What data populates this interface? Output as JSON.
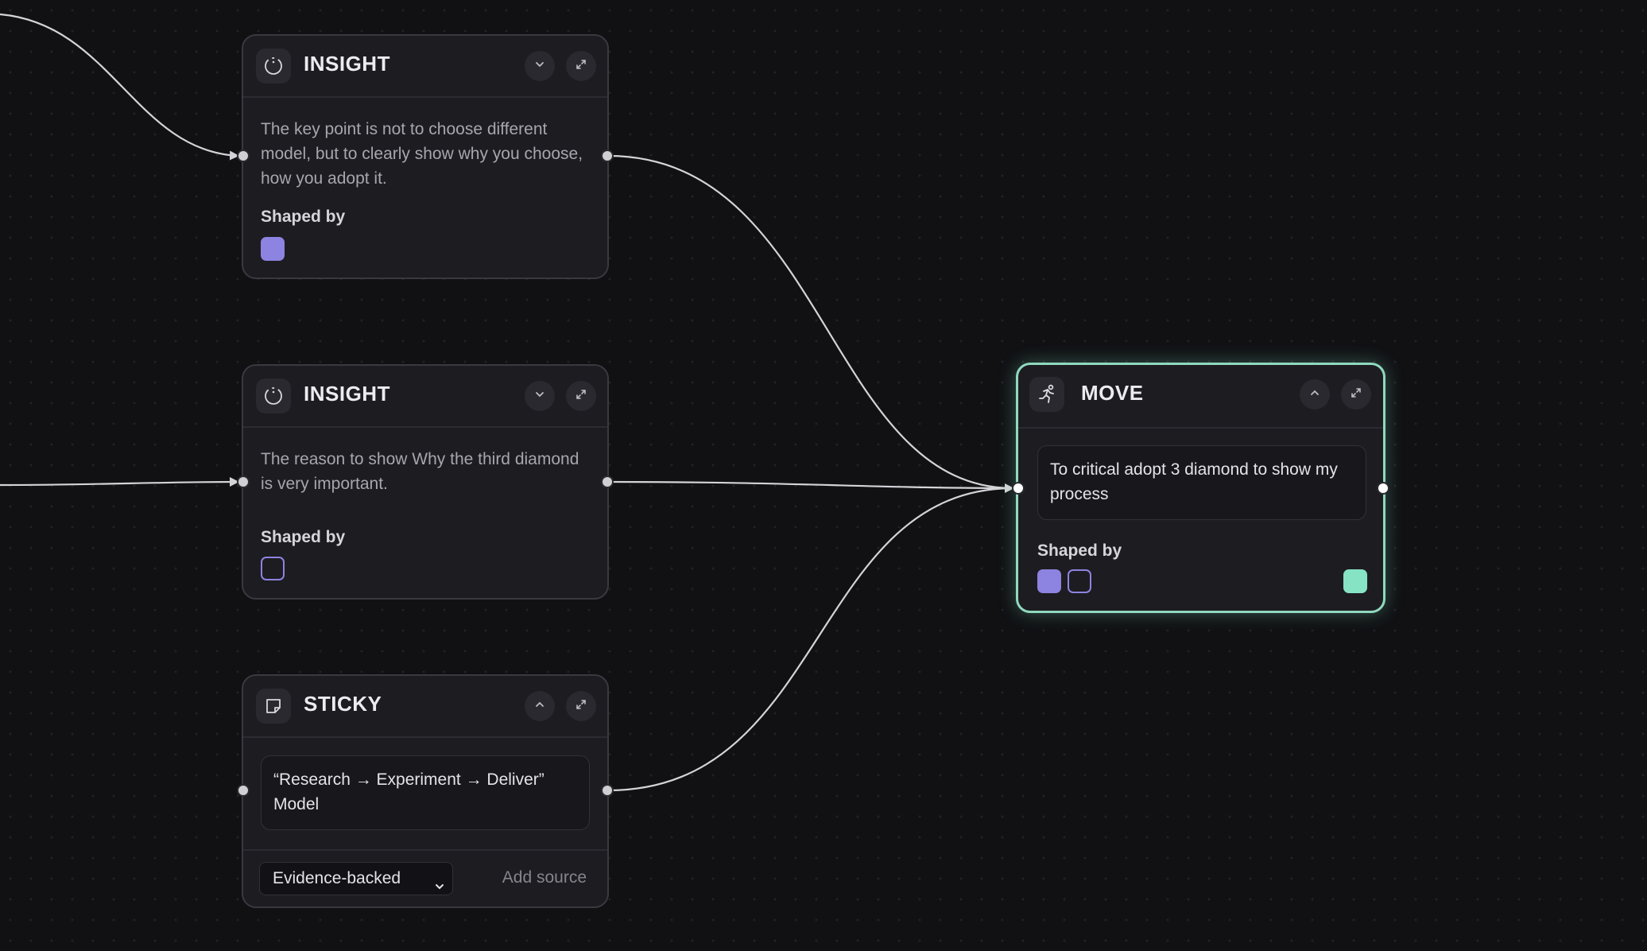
{
  "nodes": {
    "insight1": {
      "type_label": "INSIGHT",
      "body": "The key point is not to choose different model, but to clearly show why you choose, how you adopt it.",
      "shaped_by_label": "Shaped by"
    },
    "insight2": {
      "type_label": "INSIGHT",
      "body": "The reason to show Why the third diamond is very important.",
      "shaped_by_label": "Shaped by"
    },
    "sticky": {
      "type_label": "STICKY",
      "body": "“Research → Experiment → Deliver” Model",
      "evidence_select_value": "Evidence-backed",
      "add_source_label": "Add source"
    },
    "move": {
      "type_label": "MOVE",
      "body": "To critical adopt 3 diamond to show my process",
      "shaped_by_label": "Shaped by"
    }
  },
  "icons": {
    "insight": "insight-icon",
    "sticky": "sticky-note-icon",
    "move": "running-person-icon",
    "collapse": "chevron-down-icon",
    "expand": "chevron-up-icon",
    "fullscreen": "expand-icon"
  },
  "colors": {
    "canvas_bg": "#111114",
    "node_bg": "#1d1c21",
    "node_border": "#3a393f",
    "selected_border": "#8fd9bf",
    "purple_swatch": "#8d83e0",
    "green_swatch": "#86e3c3",
    "edge": "#d4d4d8"
  }
}
